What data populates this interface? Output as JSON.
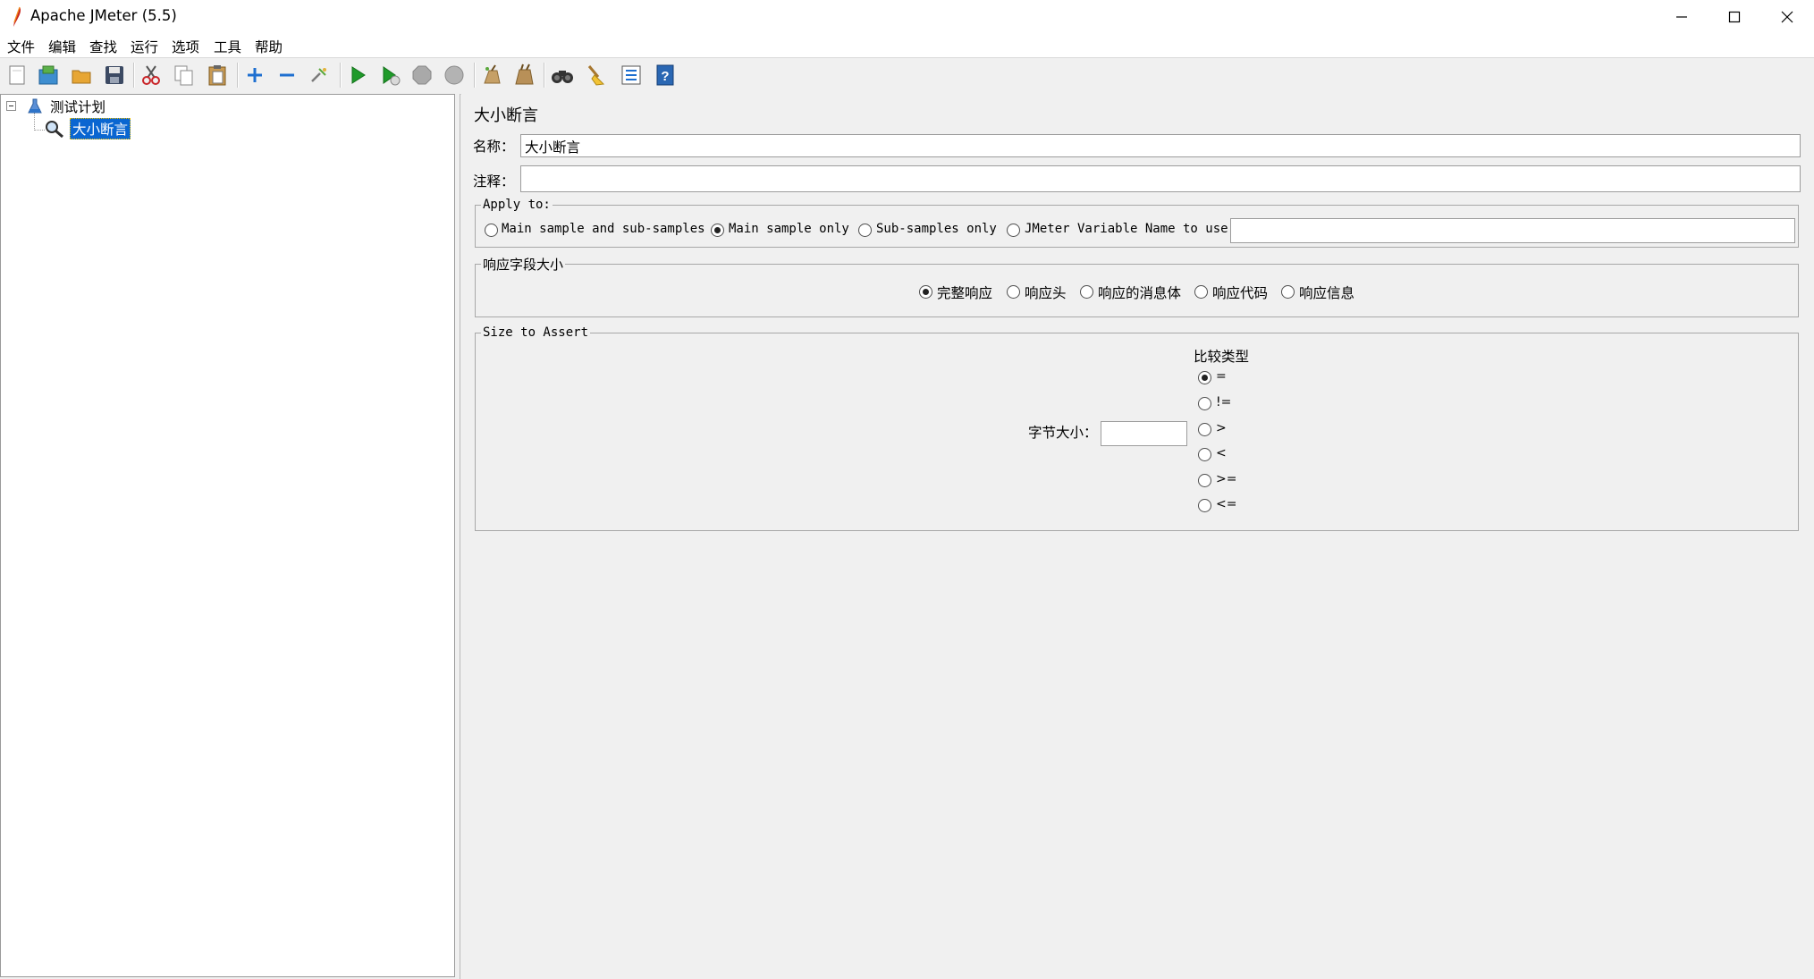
{
  "window": {
    "title": "Apache JMeter (5.5)",
    "controls": {
      "minimize": "—",
      "maximize": "☐",
      "close": "✕"
    }
  },
  "menubar": [
    "文件",
    "编辑",
    "查找",
    "运行",
    "选项",
    "工具",
    "帮助"
  ],
  "toolbar": {
    "buttons": [
      "new-icon",
      "templates-icon",
      "open-icon",
      "save-icon",
      "cut-icon",
      "copy-icon",
      "paste-icon",
      "expand-icon",
      "collapse-icon",
      "toggle-icon",
      "start-icon",
      "start-no-pause-icon",
      "stop-icon",
      "shutdown-icon",
      "clear-icon",
      "clear-all-icon",
      "search-icon",
      "reset-search-icon",
      "function-helper-icon",
      "help-icon"
    ]
  },
  "tree": {
    "root": "测试计划",
    "child": "大小断言",
    "expander": "−"
  },
  "panel": {
    "title": "大小断言",
    "name_label": "名称：",
    "name_value": "大小断言",
    "comment_label": "注释：",
    "comment_value": ""
  },
  "apply_to": {
    "legend": "Apply to:",
    "options": [
      "Main sample and sub-samples",
      "Main sample only",
      "Sub-samples only",
      "JMeter Variable Name to use"
    ],
    "selected": "Main sample only",
    "variable_value": ""
  },
  "response_field": {
    "legend": "响应字段大小",
    "options": [
      "完整响应",
      "响应头",
      "响应的消息体",
      "响应代码",
      "响应信息"
    ],
    "selected": "完整响应"
  },
  "size_assert": {
    "legend": "Size to Assert",
    "size_label": "字节大小：",
    "size_value": "",
    "compare_label": "比较类型",
    "operators": [
      "=",
      "!=",
      ">",
      "<",
      ">=",
      "<="
    ],
    "selected": "="
  },
  "colors": {
    "selection": "#0a66d1",
    "accent_blue": "#1e6fd0",
    "play_green": "#1f9a2a"
  }
}
